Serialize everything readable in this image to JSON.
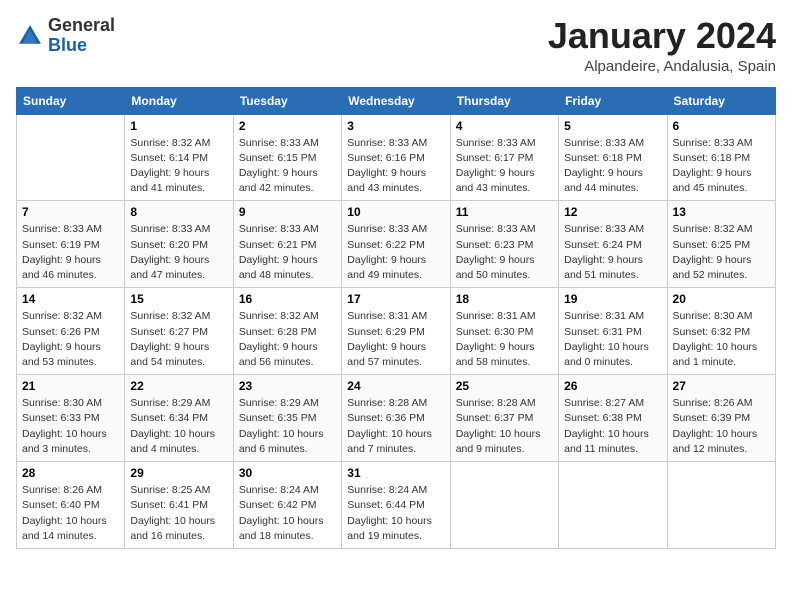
{
  "header": {
    "logo_general": "General",
    "logo_blue": "Blue",
    "month_title": "January 2024",
    "location": "Alpandeire, Andalusia, Spain"
  },
  "weekdays": [
    "Sunday",
    "Monday",
    "Tuesday",
    "Wednesday",
    "Thursday",
    "Friday",
    "Saturday"
  ],
  "weeks": [
    [
      {
        "day": "",
        "sunrise": "",
        "sunset": "",
        "daylight": ""
      },
      {
        "day": "1",
        "sunrise": "Sunrise: 8:32 AM",
        "sunset": "Sunset: 6:14 PM",
        "daylight": "Daylight: 9 hours and 41 minutes."
      },
      {
        "day": "2",
        "sunrise": "Sunrise: 8:33 AM",
        "sunset": "Sunset: 6:15 PM",
        "daylight": "Daylight: 9 hours and 42 minutes."
      },
      {
        "day": "3",
        "sunrise": "Sunrise: 8:33 AM",
        "sunset": "Sunset: 6:16 PM",
        "daylight": "Daylight: 9 hours and 43 minutes."
      },
      {
        "day": "4",
        "sunrise": "Sunrise: 8:33 AM",
        "sunset": "Sunset: 6:17 PM",
        "daylight": "Daylight: 9 hours and 43 minutes."
      },
      {
        "day": "5",
        "sunrise": "Sunrise: 8:33 AM",
        "sunset": "Sunset: 6:18 PM",
        "daylight": "Daylight: 9 hours and 44 minutes."
      },
      {
        "day": "6",
        "sunrise": "Sunrise: 8:33 AM",
        "sunset": "Sunset: 6:18 PM",
        "daylight": "Daylight: 9 hours and 45 minutes."
      }
    ],
    [
      {
        "day": "7",
        "sunrise": "Sunrise: 8:33 AM",
        "sunset": "Sunset: 6:19 PM",
        "daylight": "Daylight: 9 hours and 46 minutes."
      },
      {
        "day": "8",
        "sunrise": "Sunrise: 8:33 AM",
        "sunset": "Sunset: 6:20 PM",
        "daylight": "Daylight: 9 hours and 47 minutes."
      },
      {
        "day": "9",
        "sunrise": "Sunrise: 8:33 AM",
        "sunset": "Sunset: 6:21 PM",
        "daylight": "Daylight: 9 hours and 48 minutes."
      },
      {
        "day": "10",
        "sunrise": "Sunrise: 8:33 AM",
        "sunset": "Sunset: 6:22 PM",
        "daylight": "Daylight: 9 hours and 49 minutes."
      },
      {
        "day": "11",
        "sunrise": "Sunrise: 8:33 AM",
        "sunset": "Sunset: 6:23 PM",
        "daylight": "Daylight: 9 hours and 50 minutes."
      },
      {
        "day": "12",
        "sunrise": "Sunrise: 8:33 AM",
        "sunset": "Sunset: 6:24 PM",
        "daylight": "Daylight: 9 hours and 51 minutes."
      },
      {
        "day": "13",
        "sunrise": "Sunrise: 8:32 AM",
        "sunset": "Sunset: 6:25 PM",
        "daylight": "Daylight: 9 hours and 52 minutes."
      }
    ],
    [
      {
        "day": "14",
        "sunrise": "Sunrise: 8:32 AM",
        "sunset": "Sunset: 6:26 PM",
        "daylight": "Daylight: 9 hours and 53 minutes."
      },
      {
        "day": "15",
        "sunrise": "Sunrise: 8:32 AM",
        "sunset": "Sunset: 6:27 PM",
        "daylight": "Daylight: 9 hours and 54 minutes."
      },
      {
        "day": "16",
        "sunrise": "Sunrise: 8:32 AM",
        "sunset": "Sunset: 6:28 PM",
        "daylight": "Daylight: 9 hours and 56 minutes."
      },
      {
        "day": "17",
        "sunrise": "Sunrise: 8:31 AM",
        "sunset": "Sunset: 6:29 PM",
        "daylight": "Daylight: 9 hours and 57 minutes."
      },
      {
        "day": "18",
        "sunrise": "Sunrise: 8:31 AM",
        "sunset": "Sunset: 6:30 PM",
        "daylight": "Daylight: 9 hours and 58 minutes."
      },
      {
        "day": "19",
        "sunrise": "Sunrise: 8:31 AM",
        "sunset": "Sunset: 6:31 PM",
        "daylight": "Daylight: 10 hours and 0 minutes."
      },
      {
        "day": "20",
        "sunrise": "Sunrise: 8:30 AM",
        "sunset": "Sunset: 6:32 PM",
        "daylight": "Daylight: 10 hours and 1 minute."
      }
    ],
    [
      {
        "day": "21",
        "sunrise": "Sunrise: 8:30 AM",
        "sunset": "Sunset: 6:33 PM",
        "daylight": "Daylight: 10 hours and 3 minutes."
      },
      {
        "day": "22",
        "sunrise": "Sunrise: 8:29 AM",
        "sunset": "Sunset: 6:34 PM",
        "daylight": "Daylight: 10 hours and 4 minutes."
      },
      {
        "day": "23",
        "sunrise": "Sunrise: 8:29 AM",
        "sunset": "Sunset: 6:35 PM",
        "daylight": "Daylight: 10 hours and 6 minutes."
      },
      {
        "day": "24",
        "sunrise": "Sunrise: 8:28 AM",
        "sunset": "Sunset: 6:36 PM",
        "daylight": "Daylight: 10 hours and 7 minutes."
      },
      {
        "day": "25",
        "sunrise": "Sunrise: 8:28 AM",
        "sunset": "Sunset: 6:37 PM",
        "daylight": "Daylight: 10 hours and 9 minutes."
      },
      {
        "day": "26",
        "sunrise": "Sunrise: 8:27 AM",
        "sunset": "Sunset: 6:38 PM",
        "daylight": "Daylight: 10 hours and 11 minutes."
      },
      {
        "day": "27",
        "sunrise": "Sunrise: 8:26 AM",
        "sunset": "Sunset: 6:39 PM",
        "daylight": "Daylight: 10 hours and 12 minutes."
      }
    ],
    [
      {
        "day": "28",
        "sunrise": "Sunrise: 8:26 AM",
        "sunset": "Sunset: 6:40 PM",
        "daylight": "Daylight: 10 hours and 14 minutes."
      },
      {
        "day": "29",
        "sunrise": "Sunrise: 8:25 AM",
        "sunset": "Sunset: 6:41 PM",
        "daylight": "Daylight: 10 hours and 16 minutes."
      },
      {
        "day": "30",
        "sunrise": "Sunrise: 8:24 AM",
        "sunset": "Sunset: 6:42 PM",
        "daylight": "Daylight: 10 hours and 18 minutes."
      },
      {
        "day": "31",
        "sunrise": "Sunrise: 8:24 AM",
        "sunset": "Sunset: 6:44 PM",
        "daylight": "Daylight: 10 hours and 19 minutes."
      },
      {
        "day": "",
        "sunrise": "",
        "sunset": "",
        "daylight": ""
      },
      {
        "day": "",
        "sunrise": "",
        "sunset": "",
        "daylight": ""
      },
      {
        "day": "",
        "sunrise": "",
        "sunset": "",
        "daylight": ""
      }
    ]
  ]
}
